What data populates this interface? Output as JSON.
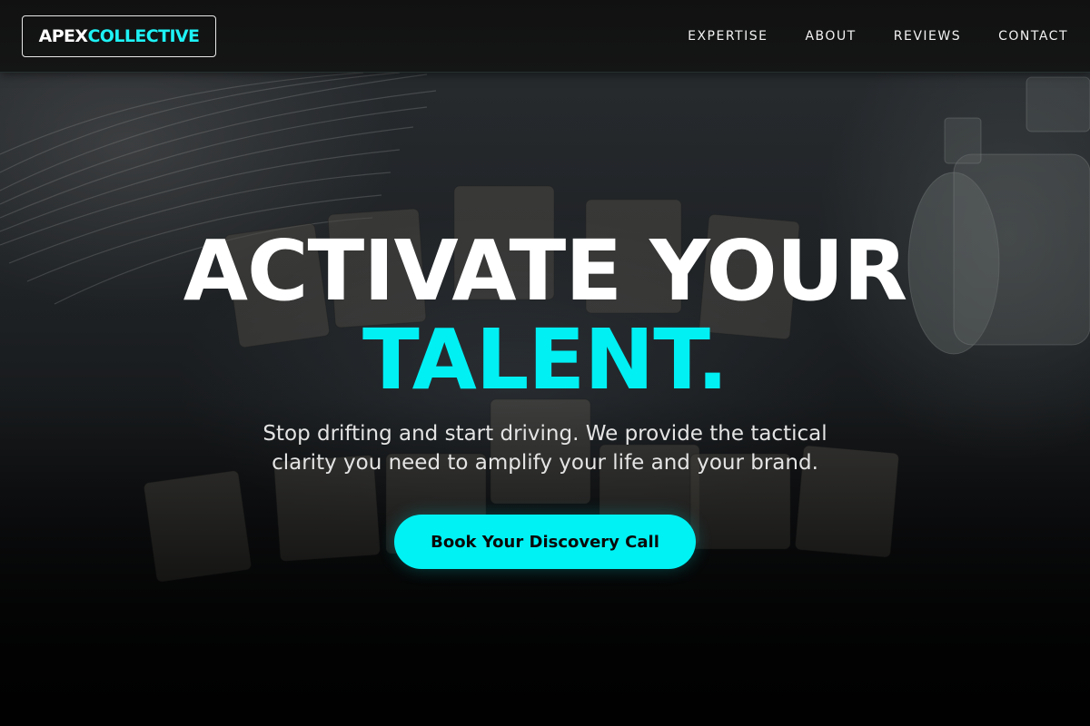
{
  "brand": {
    "part1": "APEX",
    "part2": "COLLECTIVE",
    "accent_color": "#00f0f4"
  },
  "nav": {
    "items": [
      {
        "label": "EXPERTISE"
      },
      {
        "label": "ABOUT"
      },
      {
        "label": "REVIEWS"
      },
      {
        "label": "CONTACT"
      }
    ]
  },
  "hero": {
    "headline_line1": "ACTIVATE YOUR",
    "headline_line2": "TALENT.",
    "subtext": "Stop drifting and start driving. We provide the tactical clarity you need to amplify your life and your brand.",
    "cta_label": "Book Your Discovery Call",
    "background_image": "scrabble-tiles-photo"
  }
}
